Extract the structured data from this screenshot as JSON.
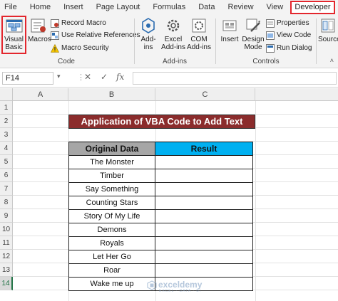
{
  "ribbon": {
    "tabs": [
      {
        "label": "File"
      },
      {
        "label": "Home"
      },
      {
        "label": "Insert"
      },
      {
        "label": "Page Layout"
      },
      {
        "label": "Formulas"
      },
      {
        "label": "Data"
      },
      {
        "label": "Review"
      },
      {
        "label": "View"
      }
    ],
    "active_tab": "Developer",
    "groups": {
      "code": {
        "label": "Code",
        "visual_basic": "Visual Basic",
        "macros": "Macros",
        "record_macro": "Record Macro",
        "relative_refs": "Use Relative References",
        "macro_security": "Macro Security"
      },
      "addins": {
        "label": "Add-ins",
        "addins": "Add-ins",
        "excel_addins": "Excel Add-ins",
        "com_addins": "COM Add-ins"
      },
      "controls": {
        "label": "Controls",
        "insert": "Insert",
        "design_mode": "Design Mode",
        "properties": "Properties",
        "view_code": "View Code",
        "run_dialog": "Run Dialog"
      },
      "xml": {
        "source": "Source"
      }
    },
    "colors": {
      "highlight": "#e3262d",
      "accent": "#217346"
    }
  },
  "formula_bar": {
    "name_box": "F14",
    "cancel_glyph": "✕",
    "enter_glyph": "✓",
    "fx_glyph": "fx",
    "formula": ""
  },
  "sheet": {
    "columns": [
      "A",
      "B",
      "C"
    ],
    "rows": [
      "1",
      "2",
      "3",
      "4",
      "5",
      "6",
      "7",
      "8",
      "9",
      "10",
      "11",
      "12",
      "13",
      "14"
    ],
    "active_row": "14",
    "title": "Application of VBA Code to Add Text",
    "header_original": "Original Data",
    "header_result": "Result",
    "data": [
      "The Monster",
      "Timber",
      "Say Something",
      "Counting Stars",
      "Story Of My Life",
      "Demons",
      "Royals",
      "Let Her Go",
      "Roar",
      "Wake me up"
    ],
    "colors": {
      "title_bg": "#8b2c2c",
      "header_original_bg": "#a6a6a6",
      "header_result_bg": "#00b0f0"
    }
  },
  "watermark": {
    "name": "exceldemy",
    "tagline": "EXCEL · DATA · BI"
  }
}
